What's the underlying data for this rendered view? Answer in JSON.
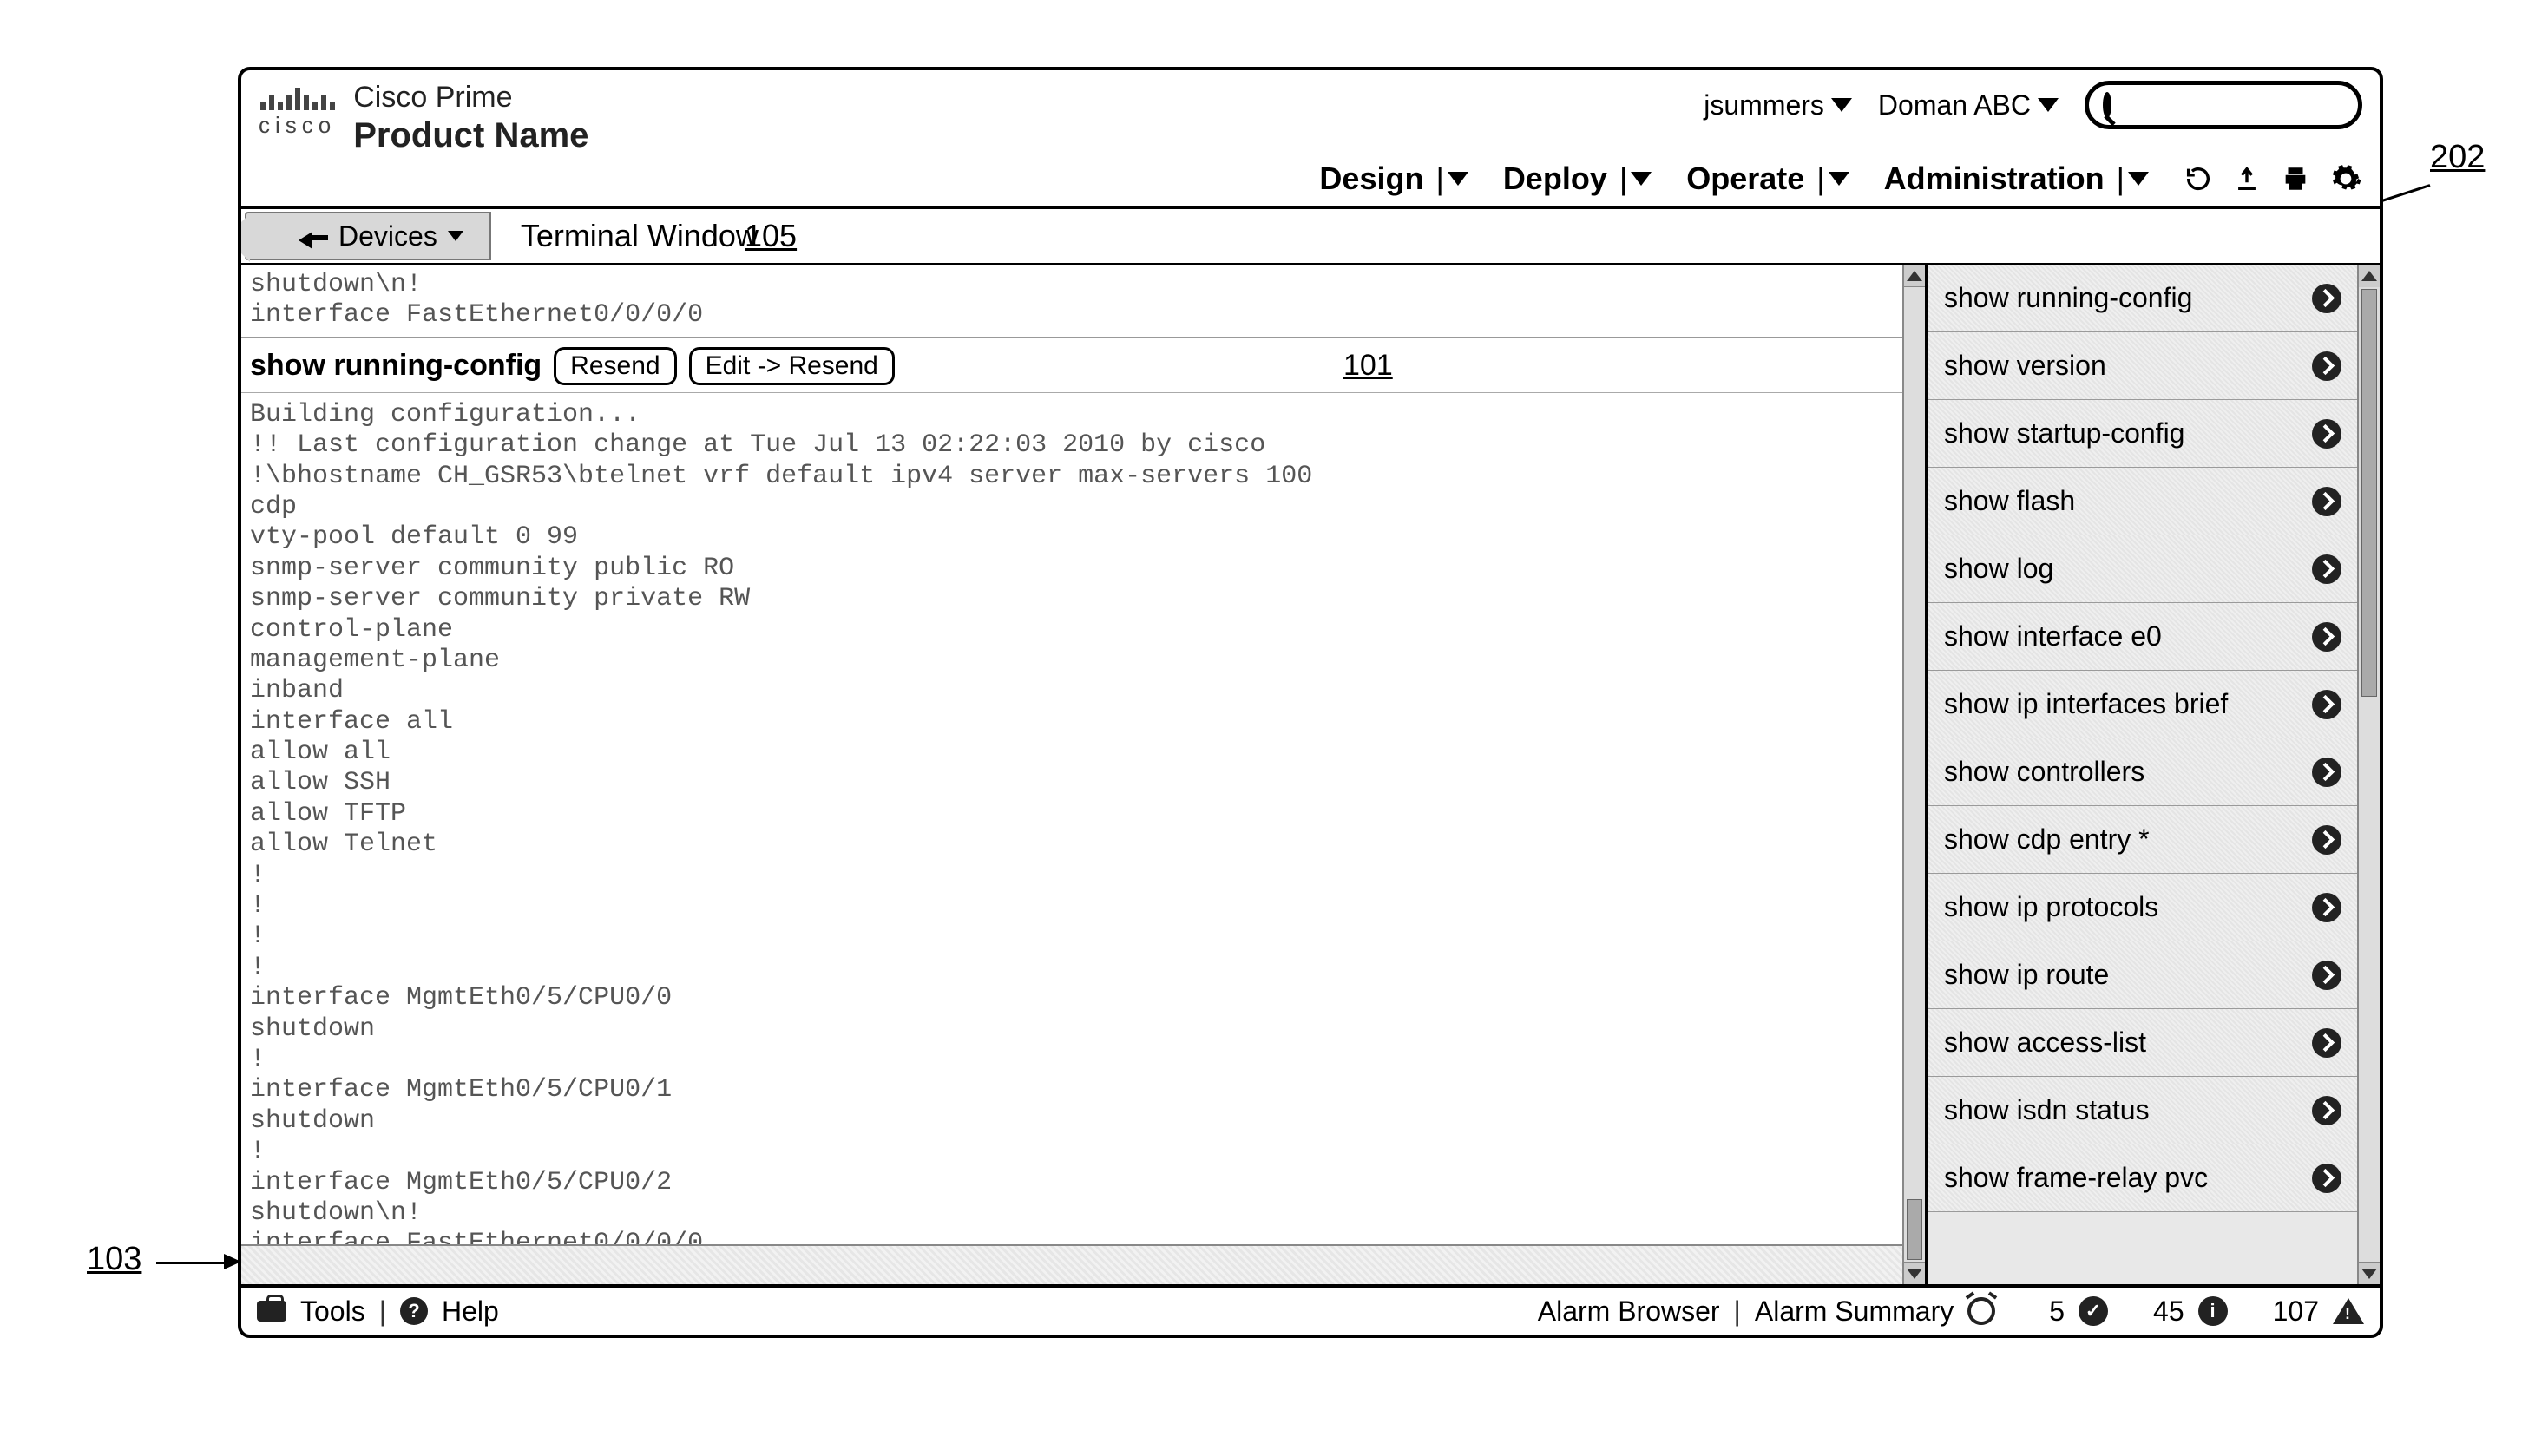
{
  "callouts": {
    "topRight": "202",
    "leftMid": "103"
  },
  "header": {
    "brandTop": "Cisco Prime",
    "brandBottom": "Product Name",
    "ciscoWord": "cisco",
    "user": "jsummers",
    "domain": "Doman ABC",
    "searchPlaceholder": "",
    "menus": [
      "Design",
      "Deploy",
      "Operate",
      "Administration"
    ]
  },
  "crumb": {
    "chip": "Devices",
    "title": "Terminal Window",
    "ref": "105"
  },
  "terminal": {
    "topLines": "shutdown\\n!\ninterface FastEthernet0/0/0/0",
    "command": "show running-config",
    "resend": "Resend",
    "editResend": "Edit -> Resend",
    "ref": "101",
    "output": "Building configuration...\n!! Last configuration change at Tue Jul 13 02:22:03 2010 by cisco\n!\\bhostname CH_GSR53\\btelnet vrf default ipv4 server max-servers 100\ncdp\nvty-pool default 0 99\nsnmp-server community public RO\nsnmp-server community private RW\ncontrol-plane\nmanagement-plane\ninband\ninterface all\nallow all\nallow SSH\nallow TFTP\nallow Telnet\n!\n!\n!\n!\ninterface MgmtEth0/5/CPU0/0\nshutdown\n!\ninterface MgmtEth0/5/CPU0/1\nshutdown\n!\ninterface MgmtEth0/5/CPU0/2\nshutdown\\n!\ninterface FastEthernet0/0/0/0"
  },
  "quickCommands": [
    "show running-config",
    "show version",
    "show startup-config",
    "show flash",
    "show log",
    "show interface e0",
    "show ip interfaces brief",
    "show controllers",
    "show cdp entry *",
    "show ip protocols",
    "show ip route",
    "show access-list",
    "show isdn status",
    "show frame-relay pvc"
  ],
  "footer": {
    "tools": "Tools",
    "help": "Help",
    "alarmBrowser": "Alarm Browser",
    "alarmSummary": "Alarm Summary",
    "count1": "5",
    "count2": "45",
    "count3": "107"
  }
}
